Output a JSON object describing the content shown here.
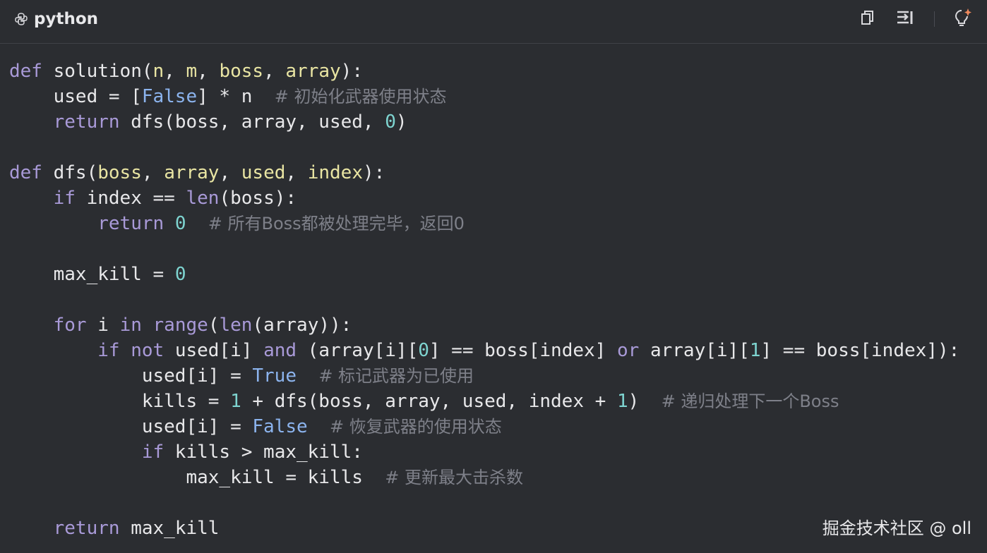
{
  "header": {
    "language": "python",
    "icons": [
      "python-logo-icon",
      "copy-icon",
      "insert-icon",
      "lightbulb-sparkle-icon"
    ]
  },
  "code": {
    "lines": [
      [
        [
          "kw",
          "def"
        ],
        [
          "t",
          " "
        ],
        [
          "fn",
          "solution"
        ],
        [
          "t",
          "("
        ],
        [
          "param",
          "n"
        ],
        [
          "t",
          ", "
        ],
        [
          "param",
          "m"
        ],
        [
          "t",
          ", "
        ],
        [
          "param",
          "boss"
        ],
        [
          "t",
          ", "
        ],
        [
          "param",
          "array"
        ],
        [
          "t",
          "):"
        ]
      ],
      [
        [
          "t",
          "    used = ["
        ],
        [
          "const",
          "False"
        ],
        [
          "t",
          "] * n  "
        ],
        [
          "cm",
          "# 初始化武器使用状态"
        ]
      ],
      [
        [
          "t",
          "    "
        ],
        [
          "kw",
          "return"
        ],
        [
          "t",
          " dfs(boss, array, used, "
        ],
        [
          "num",
          "0"
        ],
        [
          "t",
          ")"
        ]
      ],
      [],
      [
        [
          "kw",
          "def"
        ],
        [
          "t",
          " "
        ],
        [
          "fn",
          "dfs"
        ],
        [
          "t",
          "("
        ],
        [
          "param",
          "boss"
        ],
        [
          "t",
          ", "
        ],
        [
          "param",
          "array"
        ],
        [
          "t",
          ", "
        ],
        [
          "param",
          "used"
        ],
        [
          "t",
          ", "
        ],
        [
          "param",
          "index"
        ],
        [
          "t",
          "):"
        ]
      ],
      [
        [
          "t",
          "    "
        ],
        [
          "kw",
          "if"
        ],
        [
          "t",
          " index == "
        ],
        [
          "kw",
          "len"
        ],
        [
          "t",
          "(boss):"
        ]
      ],
      [
        [
          "t",
          "        "
        ],
        [
          "kw",
          "return"
        ],
        [
          "t",
          " "
        ],
        [
          "num",
          "0"
        ],
        [
          "t",
          "  "
        ],
        [
          "cm",
          "# 所有Boss都被处理完毕，返回0"
        ]
      ],
      [],
      [
        [
          "t",
          "    max_kill = "
        ],
        [
          "num",
          "0"
        ]
      ],
      [],
      [
        [
          "t",
          "    "
        ],
        [
          "kw",
          "for"
        ],
        [
          "t",
          " i "
        ],
        [
          "kw",
          "in"
        ],
        [
          "t",
          " "
        ],
        [
          "kw",
          "range"
        ],
        [
          "t",
          "("
        ],
        [
          "kw",
          "len"
        ],
        [
          "t",
          "(array)):"
        ]
      ],
      [
        [
          "t",
          "        "
        ],
        [
          "kw",
          "if"
        ],
        [
          "t",
          " "
        ],
        [
          "kw",
          "not"
        ],
        [
          "t",
          " used[i] "
        ],
        [
          "kw",
          "and"
        ],
        [
          "t",
          " (array[i]["
        ],
        [
          "num",
          "0"
        ],
        [
          "t",
          "] == boss[index] "
        ],
        [
          "kw",
          "or"
        ],
        [
          "t",
          " array[i]["
        ],
        [
          "num",
          "1"
        ],
        [
          "t",
          "] == boss[index]):"
        ]
      ],
      [
        [
          "t",
          "            used[i] = "
        ],
        [
          "const",
          "True"
        ],
        [
          "t",
          "  "
        ],
        [
          "cm",
          "# 标记武器为已使用"
        ]
      ],
      [
        [
          "t",
          "            kills = "
        ],
        [
          "num",
          "1"
        ],
        [
          "t",
          " + dfs(boss, array, used, index + "
        ],
        [
          "num",
          "1"
        ],
        [
          "t",
          ")  "
        ],
        [
          "cm",
          "# 递归处理下一个Boss"
        ]
      ],
      [
        [
          "t",
          "            used[i] = "
        ],
        [
          "const",
          "False"
        ],
        [
          "t",
          "  "
        ],
        [
          "cm",
          "# 恢复武器的使用状态"
        ]
      ],
      [
        [
          "t",
          "            "
        ],
        [
          "kw",
          "if"
        ],
        [
          "t",
          " kills > max_kill:"
        ]
      ],
      [
        [
          "t",
          "                max_kill = kills  "
        ],
        [
          "cm",
          "# 更新最大击杀数"
        ]
      ],
      [],
      [
        [
          "t",
          "    "
        ],
        [
          "kw",
          "return"
        ],
        [
          "t",
          " max_kill"
        ]
      ]
    ]
  },
  "watermark": "掘金技术社区 @ oll"
}
